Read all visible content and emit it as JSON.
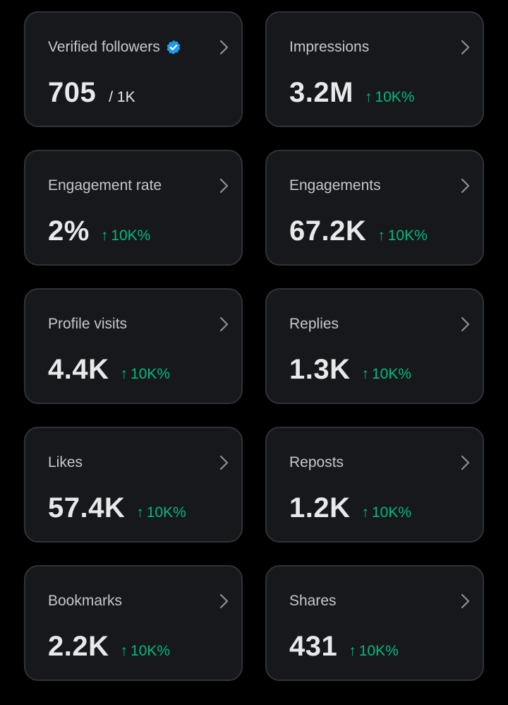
{
  "colors": {
    "background": "#000000",
    "card_background": "#16181c",
    "card_border": "#2f3336",
    "label": "#c4c8cc",
    "value": "#e7e9ea",
    "positive_change": "#00ba7c",
    "verified_badge": "#1d9bf0"
  },
  "icons": {
    "verified": "verified-badge-icon",
    "chevron": "chevron-right-icon",
    "arrow": "arrow-up-icon"
  },
  "metrics": [
    {
      "label": "Verified followers",
      "value": "705",
      "subvalue": "/ 1K",
      "verified": true
    },
    {
      "label": "Impressions",
      "value": "3.2M",
      "arrow": "↑",
      "change": "10K%"
    },
    {
      "label": "Engagement rate",
      "value": "2%",
      "arrow": "↑",
      "change": "10K%"
    },
    {
      "label": "Engagements",
      "value": "67.2K",
      "arrow": "↑",
      "change": "10K%"
    },
    {
      "label": "Profile visits",
      "value": "4.4K",
      "arrow": "↑",
      "change": "10K%"
    },
    {
      "label": "Replies",
      "value": "1.3K",
      "arrow": "↑",
      "change": "10K%"
    },
    {
      "label": "Likes",
      "value": "57.4K",
      "arrow": "↑",
      "change": "10K%"
    },
    {
      "label": "Reposts",
      "value": "1.2K",
      "arrow": "↑",
      "change": "10K%"
    },
    {
      "label": "Bookmarks",
      "value": "2.2K",
      "arrow": "↑",
      "change": "10K%"
    },
    {
      "label": "Shares",
      "value": "431",
      "arrow": "↑",
      "change": "10K%"
    }
  ]
}
